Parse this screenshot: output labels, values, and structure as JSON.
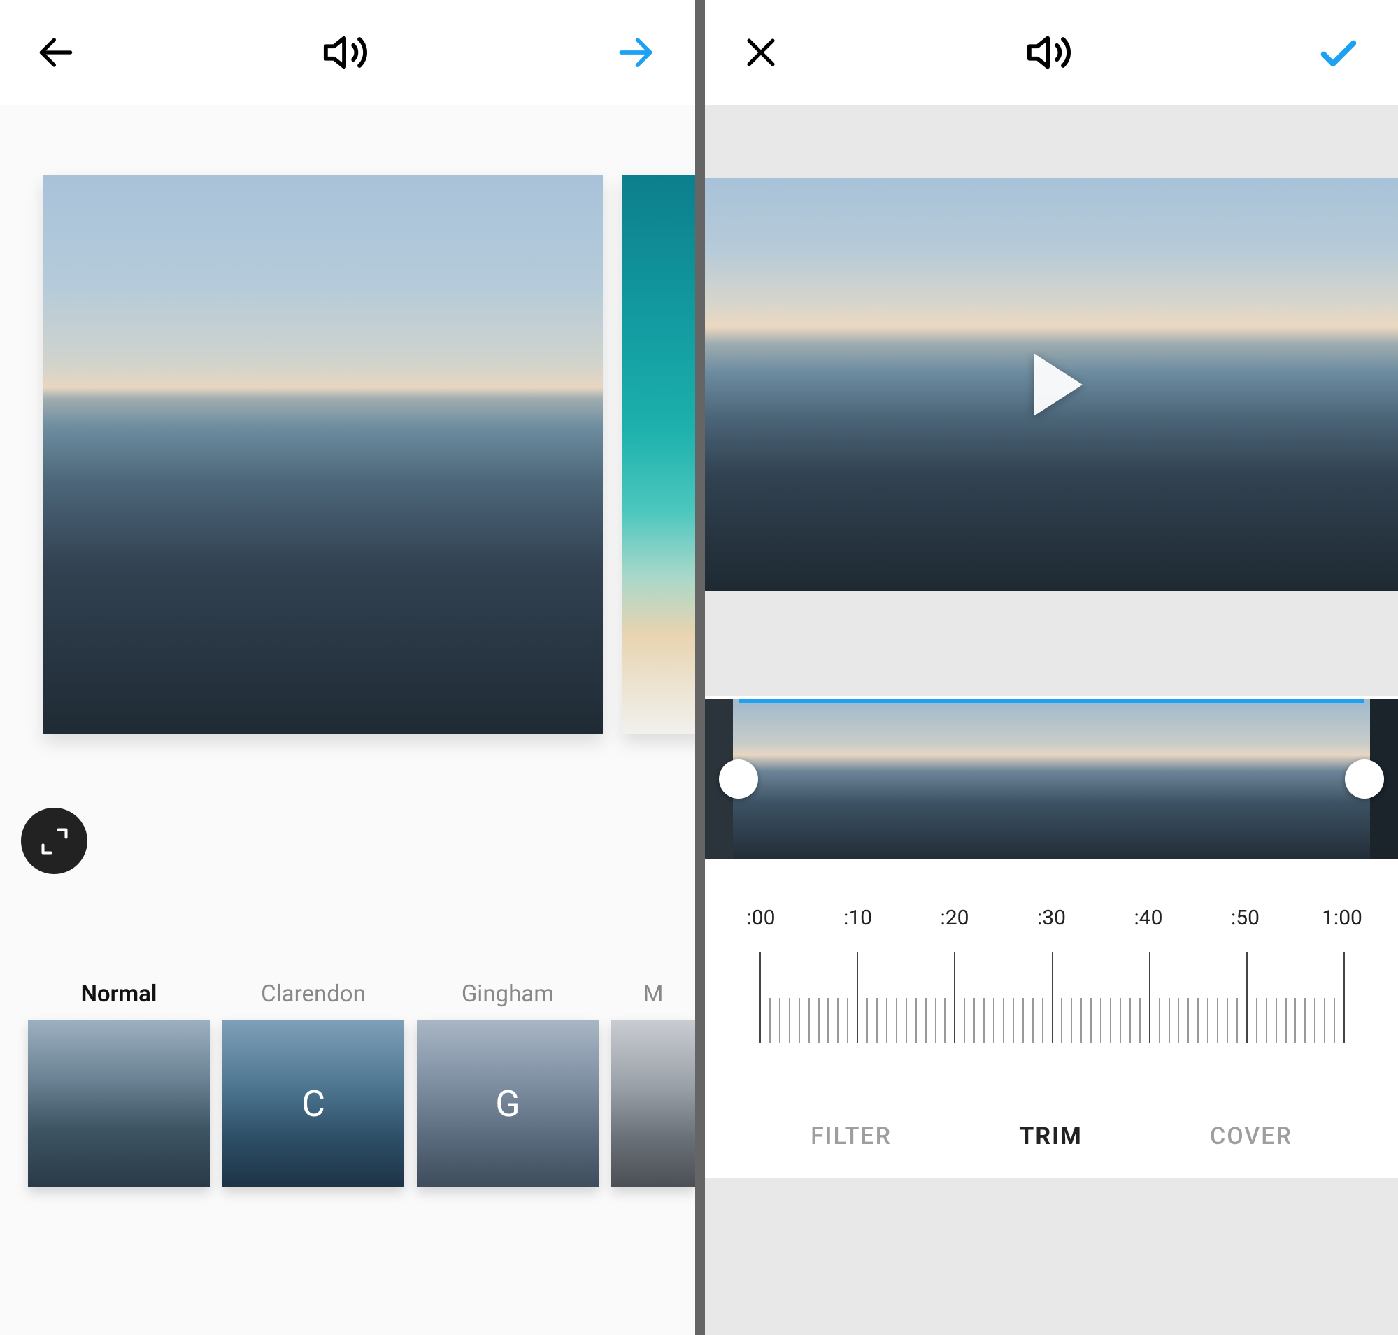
{
  "left": {
    "filters": [
      {
        "name": "Normal",
        "letter": "",
        "active": true,
        "class": "normal"
      },
      {
        "name": "Clarendon",
        "letter": "C",
        "active": false,
        "class": "clarendon"
      },
      {
        "name": "Gingham",
        "letter": "G",
        "active": false,
        "class": "gingham"
      },
      {
        "name": "M",
        "letter": "",
        "active": false,
        "class": "moon",
        "partial": true
      }
    ]
  },
  "right": {
    "ruler_labels": [
      ":00",
      ":10",
      ":20",
      ":30",
      ":40",
      ":50",
      "1:00"
    ],
    "tabs": [
      {
        "label": "FILTER",
        "active": false
      },
      {
        "label": "TRIM",
        "active": true
      },
      {
        "label": "COVER",
        "active": false
      }
    ]
  }
}
